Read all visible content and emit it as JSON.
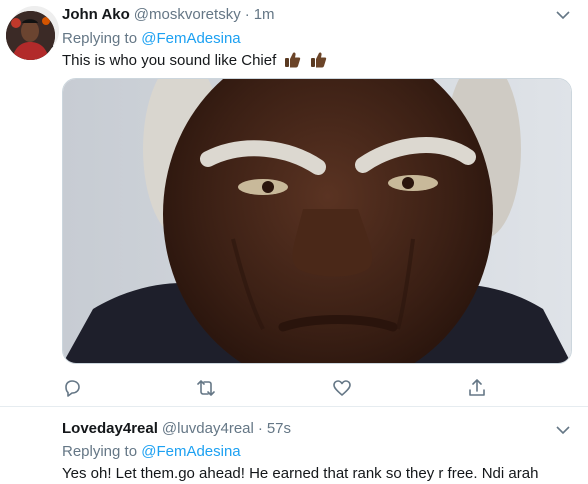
{
  "tweets": [
    {
      "name": "John Ako",
      "handle": "@moskvoretsky",
      "separator": "·",
      "time": "1m",
      "replying_label": "Replying to",
      "replying_to": "@FemAdesina",
      "text": "This is who you sound like Chief",
      "emojis": [
        "thumbs-up-dark-skin",
        "thumbs-up-dark-skin"
      ]
    },
    {
      "name": "Loveday4real",
      "handle": "@luvday4real",
      "separator": "·",
      "time": "57s",
      "replying_label": "Replying to",
      "replying_to": "@FemAdesina",
      "text": "Yes oh! Let them.go ahead! He earned that rank so they r free. Ndi arah"
    }
  ],
  "actions": [
    "reply-icon",
    "retweet-icon",
    "like-icon",
    "share-icon"
  ],
  "colors": {
    "link": "#1da1f2",
    "secondary_text": "#657786",
    "divider": "#e6ecf0",
    "action_icon": "#657786"
  }
}
